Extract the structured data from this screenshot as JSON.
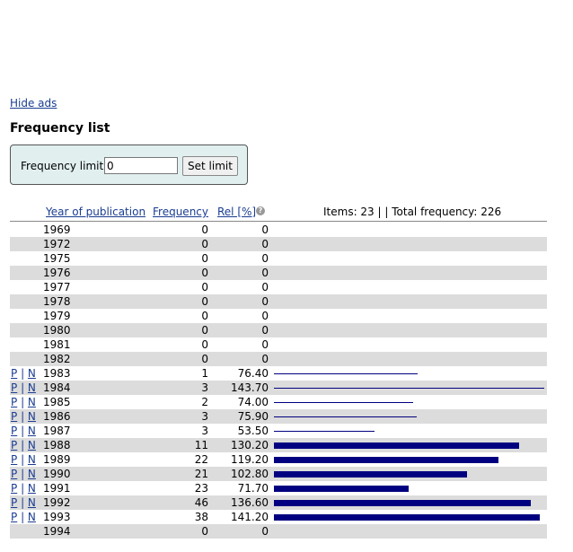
{
  "hide_ads": "Hide ads",
  "title": "Frequency list",
  "limit": {
    "label": "Frequency limit:",
    "value": "0",
    "button": "Set limit"
  },
  "columns": {
    "year": "Year of publication",
    "frequency": "Frequency",
    "rel": "Rel [%]"
  },
  "help_icon": "?",
  "summary": "Items: 23 | | Total frequency: 226",
  "links": {
    "p": "P",
    "sep": " | ",
    "n": "N"
  },
  "bar_color": "#000080",
  "max_rel": 143.7,
  "rows": [
    {
      "year": "1969",
      "frequency": "0",
      "rel": "0",
      "links": false
    },
    {
      "year": "1972",
      "frequency": "0",
      "rel": "0",
      "links": false
    },
    {
      "year": "1975",
      "frequency": "0",
      "rel": "0",
      "links": false
    },
    {
      "year": "1976",
      "frequency": "0",
      "rel": "0",
      "links": false
    },
    {
      "year": "1977",
      "frequency": "0",
      "rel": "0",
      "links": false
    },
    {
      "year": "1978",
      "frequency": "0",
      "rel": "0",
      "links": false
    },
    {
      "year": "1979",
      "frequency": "0",
      "rel": "0",
      "links": false
    },
    {
      "year": "1980",
      "frequency": "0",
      "rel": "0",
      "links": false
    },
    {
      "year": "1981",
      "frequency": "0",
      "rel": "0",
      "links": false
    },
    {
      "year": "1982",
      "frequency": "0",
      "rel": "0",
      "links": false
    },
    {
      "year": "1983",
      "frequency": "1",
      "rel": "76.40",
      "links": true
    },
    {
      "year": "1984",
      "frequency": "3",
      "rel": "143.70",
      "links": true
    },
    {
      "year": "1985",
      "frequency": "2",
      "rel": "74.00",
      "links": true
    },
    {
      "year": "1986",
      "frequency": "3",
      "rel": "75.90",
      "links": true
    },
    {
      "year": "1987",
      "frequency": "3",
      "rel": "53.50",
      "links": true
    },
    {
      "year": "1988",
      "frequency": "11",
      "rel": "130.20",
      "links": true
    },
    {
      "year": "1989",
      "frequency": "22",
      "rel": "119.20",
      "links": true
    },
    {
      "year": "1990",
      "frequency": "21",
      "rel": "102.80",
      "links": true
    },
    {
      "year": "1991",
      "frequency": "23",
      "rel": "71.70",
      "links": true
    },
    {
      "year": "1992",
      "frequency": "46",
      "rel": "136.60",
      "links": true
    },
    {
      "year": "1993",
      "frequency": "38",
      "rel": "141.20",
      "links": true
    },
    {
      "year": "1994",
      "frequency": "0",
      "rel": "0",
      "links": false
    }
  ]
}
